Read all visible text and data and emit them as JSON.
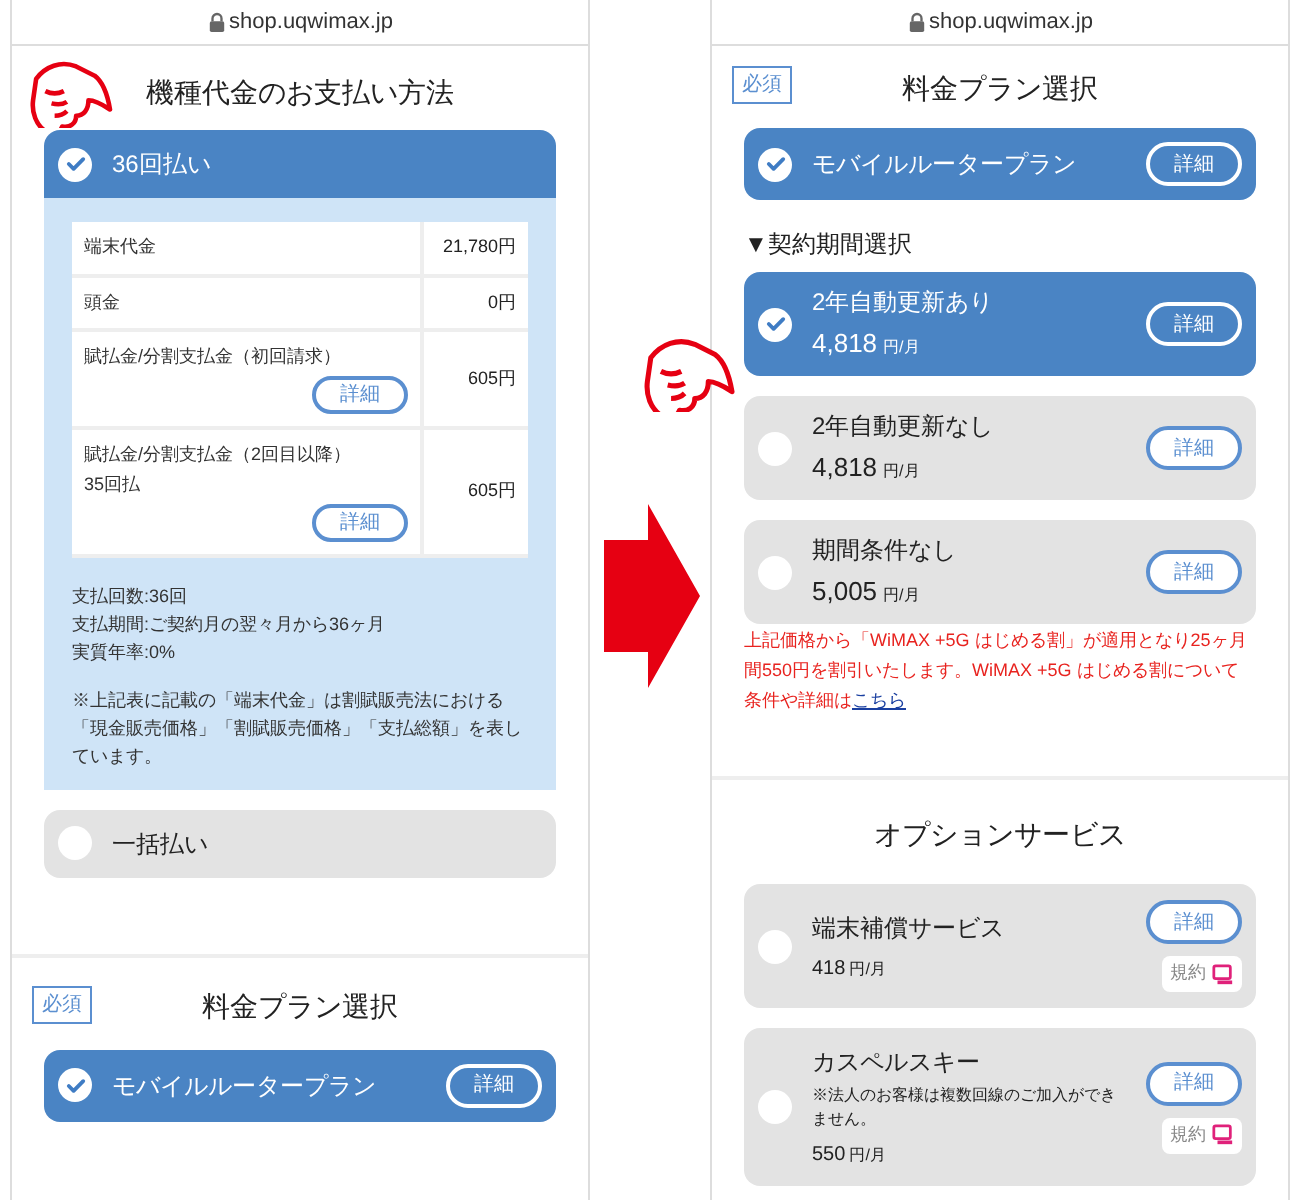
{
  "left_screen": {
    "url": "shop.uqwimax.jp",
    "payment_section": {
      "title": "機種代金のお支払い方法",
      "options": [
        {
          "label": "36回払い",
          "selected": true,
          "table": [
            {
              "label": "端末代金",
              "value": "21,780円"
            },
            {
              "label": "頭金",
              "value": "0円"
            },
            {
              "label": "賦払金/分割支払金（初回請求）",
              "value": "605円",
              "detail": "詳細"
            },
            {
              "label": "賦払金/分割支払金（2回目以降）",
              "sublabel": "35回払",
              "value": "605円",
              "detail": "詳細"
            }
          ],
          "notes": [
            "支払回数:36回",
            "支払期間:ご契約月の翌々月から36ヶ月",
            "実質年率:0%"
          ],
          "disclaimer": "※上記表に記載の「端末代金」は割賦販売法における「現金販売価格」「割賦販売価格」「支払総額」を表しています。"
        },
        {
          "label": "一括払い",
          "selected": false
        }
      ]
    },
    "plan_section": {
      "badge": "必須",
      "title": "料金プラン選択",
      "plans": [
        {
          "label": "モバイルルータープラン",
          "selected": true,
          "detail": "詳細"
        }
      ]
    }
  },
  "right_screen": {
    "url": "shop.uqwimax.jp",
    "plan_section": {
      "badge": "必須",
      "title": "料金プラン選択",
      "plans": [
        {
          "label": "モバイルルータープラン",
          "selected": true,
          "detail": "詳細"
        }
      ],
      "contract_heading": "▼契約期間選択",
      "contracts": [
        {
          "label": "2年自動更新あり",
          "price": "4,818",
          "unit": "円/月",
          "selected": true,
          "detail": "詳細"
        },
        {
          "label": "2年自動更新なし",
          "price": "4,818",
          "unit": "円/月",
          "selected": false,
          "detail": "詳細"
        },
        {
          "label": "期間条件なし",
          "price": "5,005",
          "unit": "円/月",
          "selected": false,
          "detail": "詳細"
        }
      ],
      "note": "上記価格から「WiMAX +5G はじめる割」が適用となり25ヶ月間550円を割引いたします。WiMAX +5G はじめる割について条件や詳細は",
      "note_link": "こちら"
    },
    "option_section": {
      "title": "オプションサービス",
      "options": [
        {
          "label": "端末補償サービス",
          "price": "418",
          "unit": "円/月",
          "selected": false,
          "detail": "詳細",
          "terms": "規約"
        },
        {
          "label": "カスペルスキー",
          "note": "※法人のお客様は複数回線のご加入ができません。",
          "price": "550",
          "unit": "円/月",
          "selected": false,
          "detail": "詳細",
          "terms": "規約"
        }
      ]
    }
  }
}
